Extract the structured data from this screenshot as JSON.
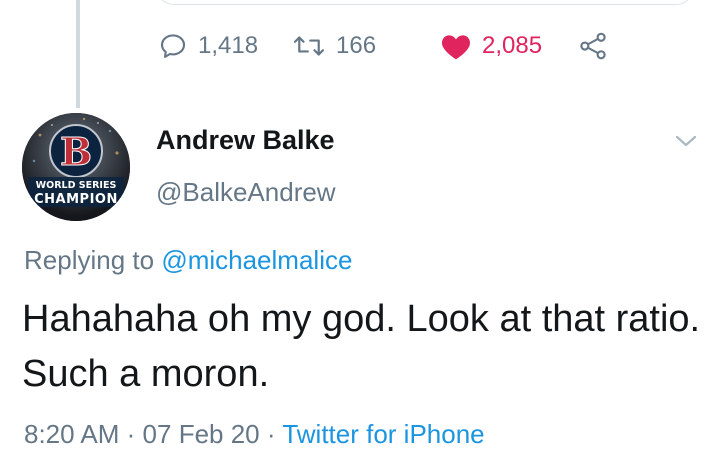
{
  "prev_tweet": {
    "replies": "1,418",
    "retweets": "166",
    "likes": "2,085"
  },
  "tweet": {
    "author_name": "Andrew Balke",
    "author_handle": "@BalkeAndrew",
    "avatar_text": {
      "top": "WORLD SERIES",
      "bottom": "CHAMPION",
      "letter": "B"
    },
    "replying_prefix": "Replying to",
    "replying_to": "@michaelmalice",
    "text": "Hahahaha oh my god. Look at that ratio. Such a moron.",
    "time": "8:20 AM",
    "date": "07 Feb 20",
    "source": "Twitter for iPhone",
    "separator": "·"
  },
  "colors": {
    "like": "#e0245e",
    "link": "#1b95e0",
    "muted": "#657786",
    "text": "#14171a"
  },
  "icons": [
    "reply-icon",
    "retweet-icon",
    "heart-icon",
    "share-icon",
    "chevron-down-icon"
  ]
}
